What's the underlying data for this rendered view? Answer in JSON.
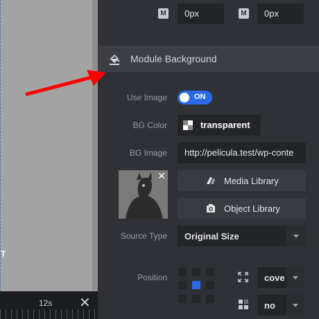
{
  "canvas": {
    "text_fragment": "T"
  },
  "timeline": {
    "time_label": "12s"
  },
  "margin_row": {
    "badge": "M",
    "field_1": "0px",
    "field_2": "0px"
  },
  "section": {
    "title": "Module Background",
    "icon": "paint-bucket-icon"
  },
  "use_image": {
    "label": "Use Image",
    "toggle": "ON"
  },
  "bg_color": {
    "label": "BG Color",
    "value": "transparent"
  },
  "bg_image": {
    "label": "BG Image",
    "url": "http://pelicula.test/wp-conte"
  },
  "buttons": {
    "media_library": "Media Library",
    "object_library": "Object Library"
  },
  "source_type": {
    "label": "Source Type",
    "value": "Original Size"
  },
  "position": {
    "label": "Position",
    "size_value": "cove",
    "repeat_value": "no"
  },
  "colors": {
    "accent": "#2a6ae9",
    "annotation_arrow": "#ff0000"
  }
}
